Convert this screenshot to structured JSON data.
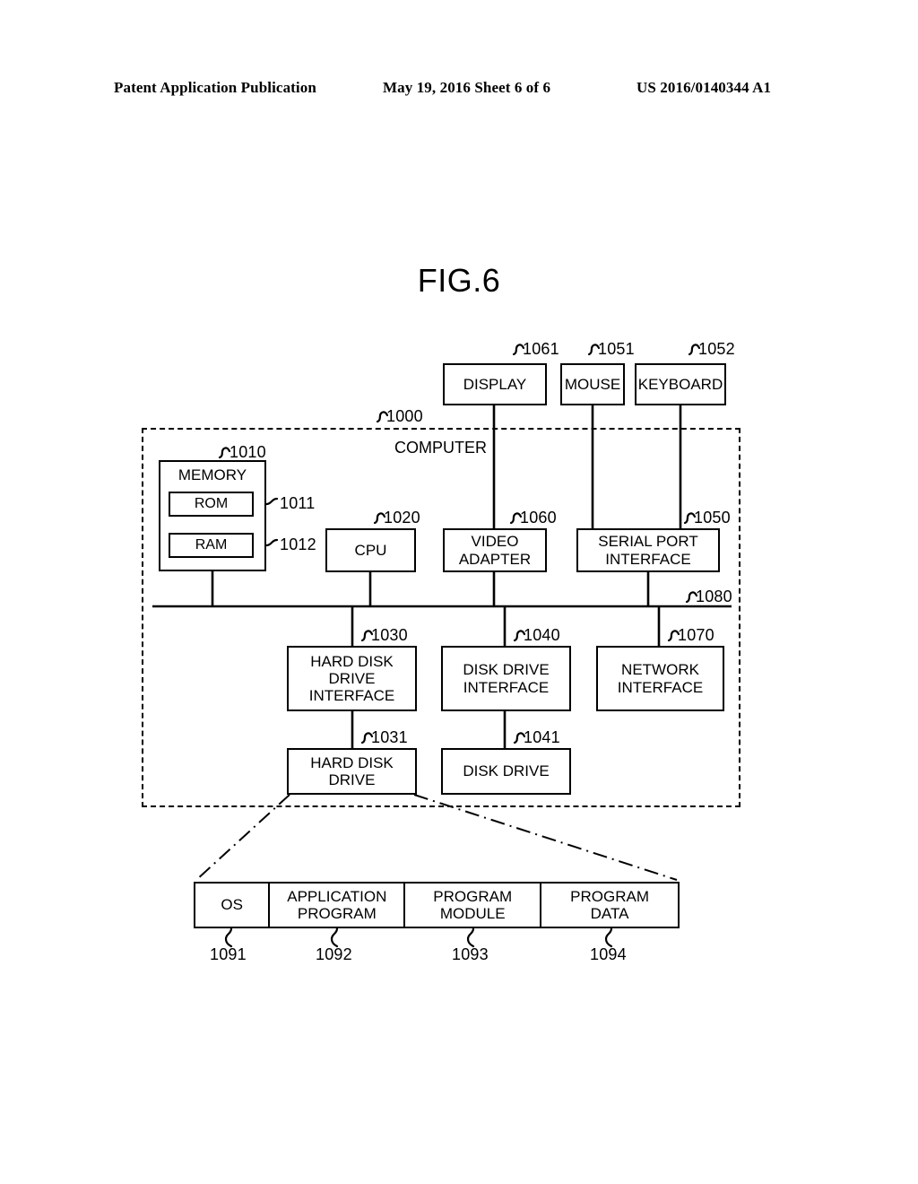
{
  "header": {
    "left": "Patent Application Publication",
    "center": "May 19, 2016  Sheet 6 of 6",
    "right": "US 2016/0140344 A1"
  },
  "figure": {
    "title": "FIG.6",
    "enclosure_label": "COMPUTER",
    "enclosure_ref": "1000"
  },
  "blocks": {
    "display": {
      "label": "DISPLAY",
      "ref": "1061"
    },
    "mouse": {
      "label": "MOUSE",
      "ref": "1051"
    },
    "keyboard": {
      "label": "KEYBOARD",
      "ref": "1052"
    },
    "memory": {
      "label": "MEMORY",
      "ref": "1010"
    },
    "rom": {
      "label": "ROM",
      "ref": "1011"
    },
    "ram": {
      "label": "RAM",
      "ref": "1012"
    },
    "cpu": {
      "label": "CPU",
      "ref": "1020"
    },
    "video_adapter": {
      "label": "VIDEO\nADAPTER",
      "ref": "1060"
    },
    "serial_port": {
      "label": "SERIAL PORT\nINTERFACE",
      "ref": "1050"
    },
    "bus": {
      "label": "",
      "ref": "1080"
    },
    "hdd_interface": {
      "label": "HARD DISK\nDRIVE\nINTERFACE",
      "ref": "1030"
    },
    "dd_interface": {
      "label": "DISK DRIVE\nINTERFACE",
      "ref": "1040"
    },
    "net_interface": {
      "label": "NETWORK\nINTERFACE",
      "ref": "1070"
    },
    "hard_disk": {
      "label": "HARD DISK\nDRIVE",
      "ref": "1031"
    },
    "disk_drive": {
      "label": "DISK DRIVE",
      "ref": "1041"
    }
  },
  "storage_table": {
    "cells": [
      {
        "label": "OS",
        "ref": "1091"
      },
      {
        "label": "APPLICATION\nPROGRAM",
        "ref": "1092"
      },
      {
        "label": "PROGRAM\nMODULE",
        "ref": "1093"
      },
      {
        "label": "PROGRAM\nDATA",
        "ref": "1094"
      }
    ]
  },
  "colors": {
    "ink": "#000000",
    "paper": "#ffffff"
  }
}
